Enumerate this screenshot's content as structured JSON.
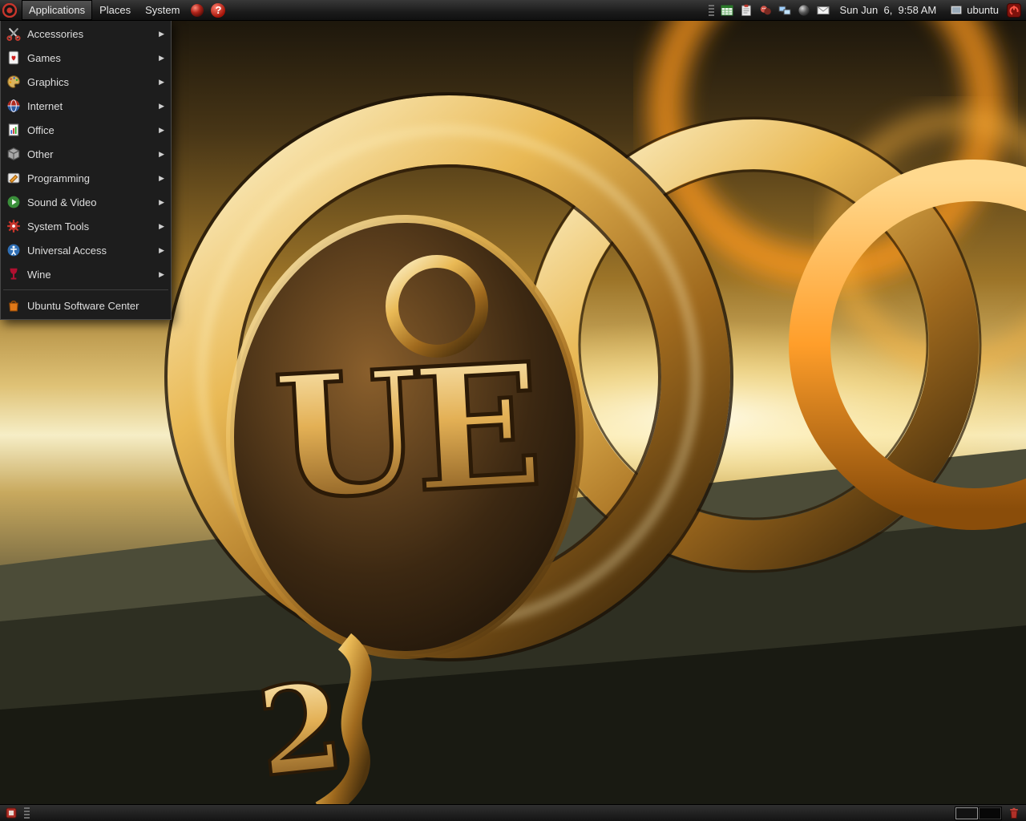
{
  "ui": {
    "submenu_arrow": "▶",
    "help_glyph": "?"
  },
  "top_panel": {
    "menus": [
      {
        "label": "Applications"
      },
      {
        "label": "Places"
      },
      {
        "label": "System"
      }
    ],
    "launchers": [
      "web-browser",
      "help"
    ],
    "tray_icons": [
      "spreadsheet-indicator",
      "clipboard-indicator",
      "messaging-indicator",
      "network-indicator",
      "volume-indicator",
      "mail-indicator"
    ],
    "clock": "Sun Jun  6,  9:58 AM",
    "user": "ubuntu"
  },
  "applications_menu": {
    "items": [
      {
        "label": "Accessories"
      },
      {
        "label": "Games"
      },
      {
        "label": "Graphics"
      },
      {
        "label": "Internet"
      },
      {
        "label": "Office"
      },
      {
        "label": "Other"
      },
      {
        "label": "Programming"
      },
      {
        "label": "Sound & Video"
      },
      {
        "label": "System Tools"
      },
      {
        "label": "Universal Access"
      },
      {
        "label": "Wine"
      }
    ],
    "footer": {
      "label": "Ubuntu Software Center"
    }
  },
  "wallpaper": {
    "logo_text": "UE",
    "accent_text": "2"
  },
  "bottom_panel": {
    "workspaces": 2
  }
}
